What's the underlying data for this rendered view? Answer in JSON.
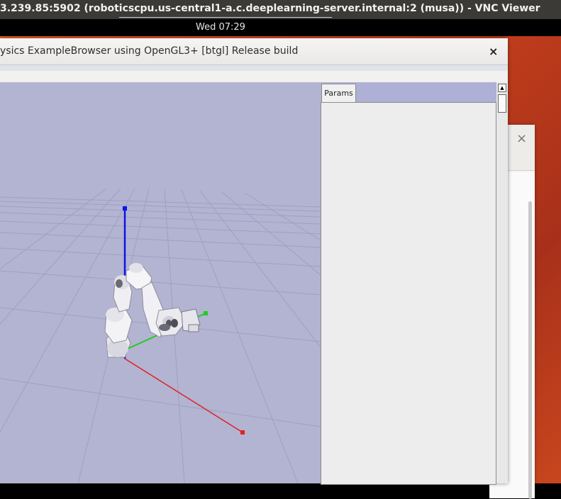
{
  "vnc": {
    "title": "3.239.85:5902 (roboticscpu.us-central1-a.c.deeplearning-server.internal:2 (musa)) - VNC Viewer"
  },
  "topbar": {
    "clock": "Wed 07:29"
  },
  "window": {
    "title": "ysics ExampleBrowser using OpenGL3+ [btgl] Release build",
    "close": "×"
  },
  "back_window": {
    "close": "×"
  },
  "panel": {
    "tab_label": "Params",
    "scroll_up": "▲"
  },
  "colors": {
    "viewport_bg": "#b3b3d2",
    "axis_x": "#e02020",
    "axis_y": "#20d020",
    "axis_z": "#0000e0",
    "desktop": "#d9481f"
  },
  "icons": {
    "close": "close-icon",
    "scroll_up": "arrow-up-icon"
  }
}
